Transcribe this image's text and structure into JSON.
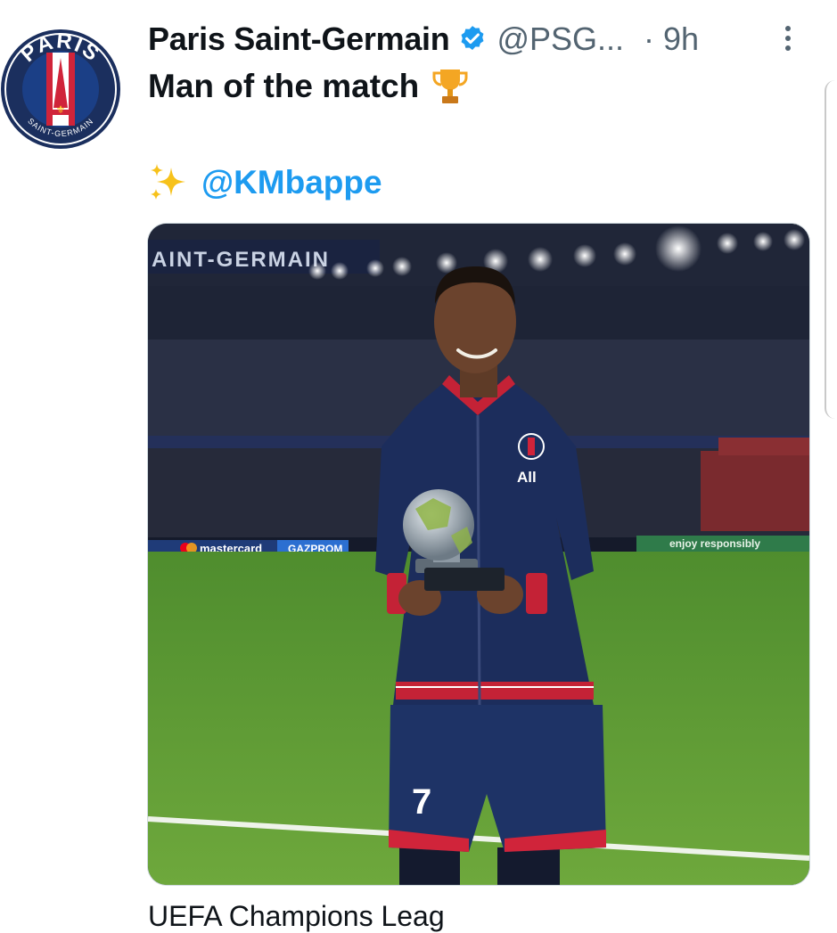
{
  "tweet": {
    "author_name": "Paris Saint-Germain",
    "handle": "@PSG...",
    "time": "· 9h",
    "text": "Man of the match",
    "mention": "@KMbappe",
    "next_line": "UEFA Champions Leag"
  },
  "avatar": {
    "logo_text_top": "PARIS",
    "logo_text_bottom": "SAINT-GERMAIN"
  },
  "photo": {
    "stadium_banner": "AINT-GERMAIN",
    "ad_board_left": "mastercard",
    "ad_board_mid": "GAZPROM",
    "ad_board_right": "enjoy responsibly",
    "shirt_number": "7",
    "sponsor": "All"
  },
  "colors": {
    "link": "#1d9bf0",
    "verified": "#1d9bf0",
    "psg_navy": "#1b2f5e",
    "psg_red": "#d0243a",
    "muted": "#536471"
  },
  "icons": [
    "verified-badge-icon",
    "more-options-icon",
    "trophy-icon",
    "sparkles-icon"
  ]
}
